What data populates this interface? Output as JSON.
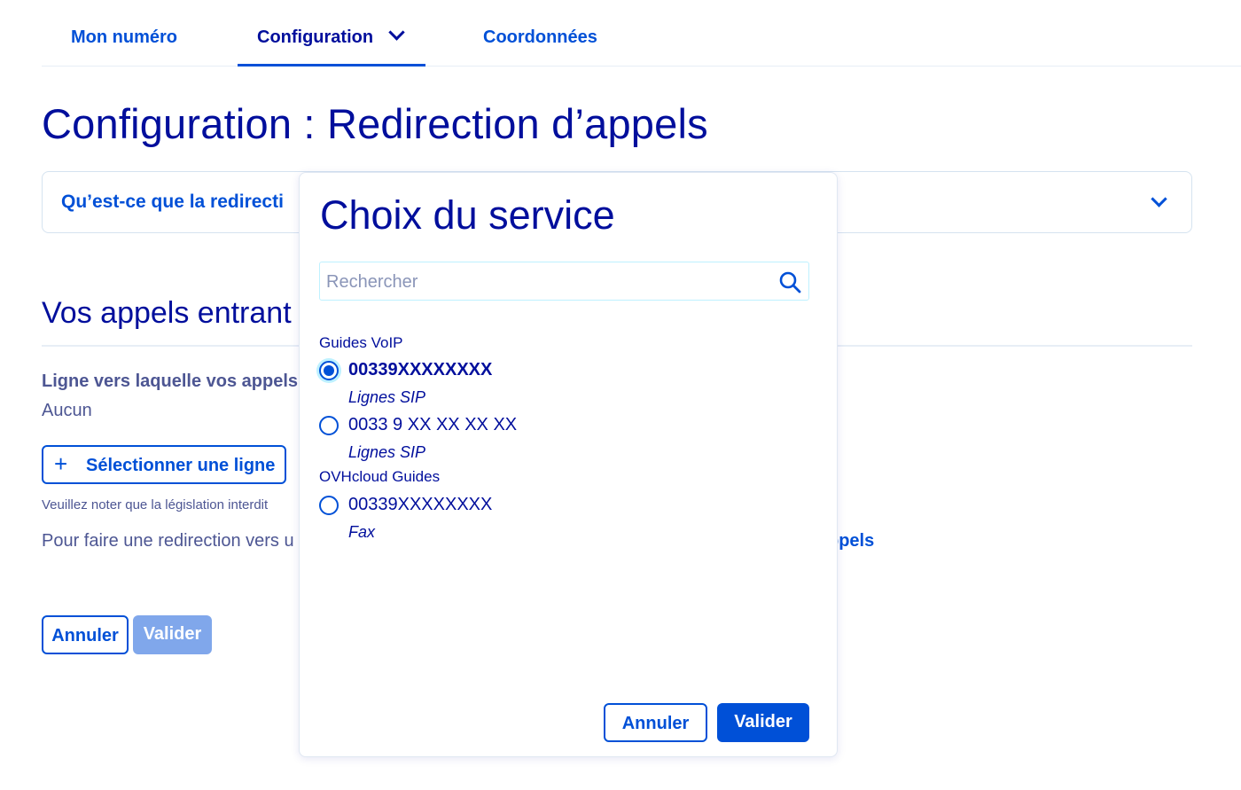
{
  "nav": {
    "tabs": [
      {
        "label": "Mon numéro"
      },
      {
        "label": "Configuration"
      },
      {
        "label": "Coordonnées"
      }
    ]
  },
  "page": {
    "title": "Configuration : Redirection d’appels",
    "faq_label": "Qu’est-ce que la redirecti",
    "section_title": "Vos appels entrant",
    "line_label": "Ligne vers laquelle vos appels",
    "line_value": "Aucun",
    "select_line_button": "Sélectionner une ligne",
    "note": "Veuillez noter que la législation interdit",
    "redirect_text": "Pour faire une redirection vers u",
    "redirect_link": "ppels",
    "cancel_button": "Annuler",
    "validate_button": "Valider"
  },
  "modal": {
    "title": "Choix du service",
    "search_placeholder": "Rechercher",
    "groups": [
      {
        "label": "Guides VoIP",
        "options": [
          {
            "number": "00339XXXXXXXX",
            "type": "Lignes SIP",
            "selected": true
          },
          {
            "number": "0033 9 XX XX XX XX",
            "type": "Lignes SIP",
            "selected": false
          }
        ]
      },
      {
        "label": "OVHcloud Guides",
        "options": [
          {
            "number": "00339XXXXXXXX",
            "type": "Fax",
            "selected": false
          }
        ]
      }
    ],
    "cancel_button": "Annuler",
    "validate_button": "Valider"
  },
  "colors": {
    "primary": "#0050d7",
    "heading": "#000e9c",
    "text_muted": "#4d5693",
    "disabled_button": "#80a7eb"
  }
}
